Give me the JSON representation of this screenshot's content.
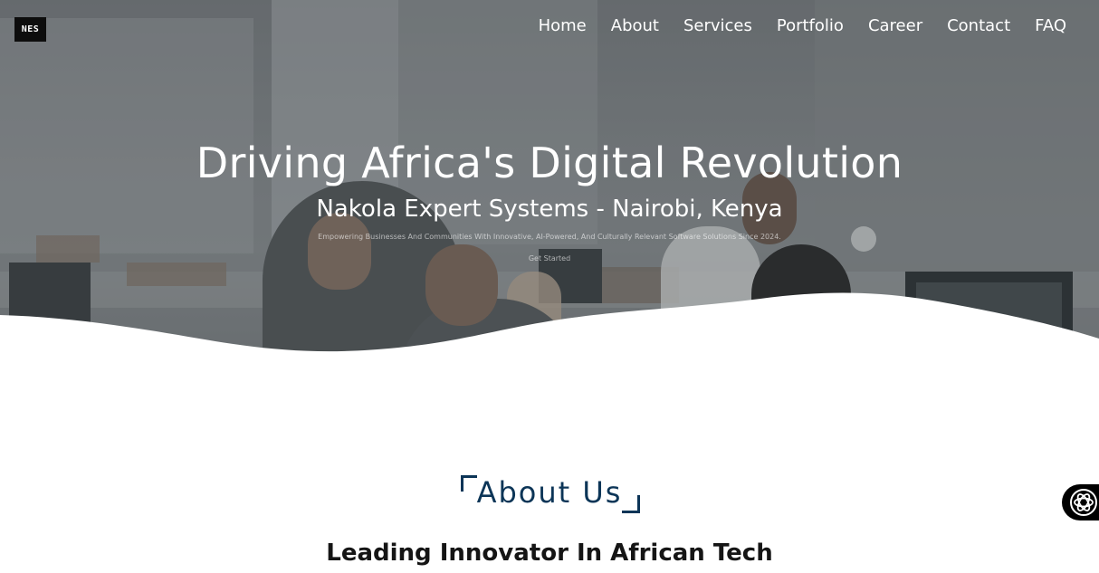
{
  "brand": {
    "logo_text": "NES"
  },
  "nav": {
    "items": [
      "Home",
      "About",
      "Services",
      "Portfolio",
      "Career",
      "Contact",
      "FAQ"
    ]
  },
  "hero": {
    "title": "Driving Africa's Digital Revolution",
    "subtitle": "Nakola Expert Systems - Nairobi, Kenya",
    "tagline": "Empowering Businesses And Communities With Innovative, AI-Powered, And Culturally Relevant Software Solutions Since 2024.",
    "cta_label": "Get Started"
  },
  "about": {
    "heading": "About Us",
    "subheading": "Leading Innovator In African Tech"
  },
  "colors": {
    "about_heading": "#0c3557",
    "logo_bg": "#0d0d0d",
    "chat_bg": "#000000"
  },
  "icons": {
    "chat_widget": "ai-assistant-icon"
  }
}
